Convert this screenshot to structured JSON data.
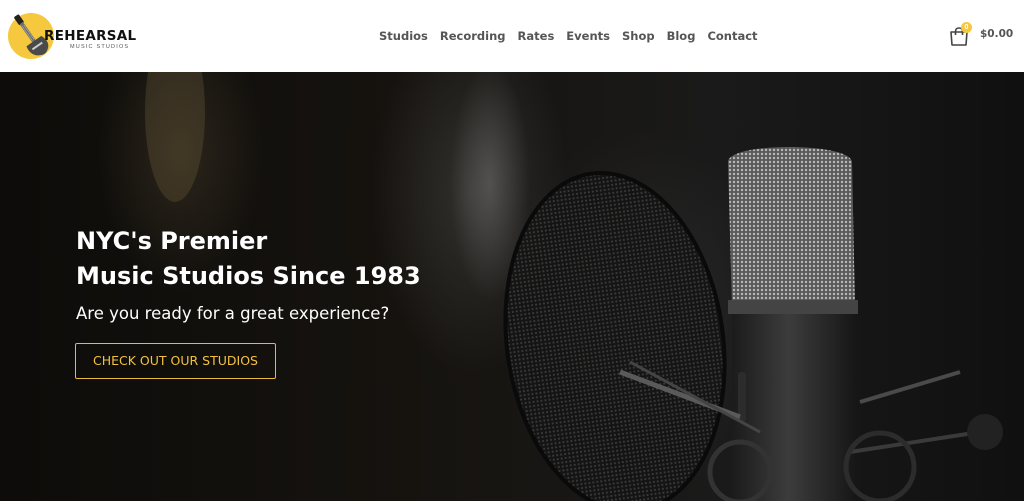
{
  "brand": {
    "name": "REHEARSAL",
    "tagline": "MUSIC STUDIOS",
    "accent_color": "#f5c83d"
  },
  "nav": {
    "items": [
      {
        "label": "Studios"
      },
      {
        "label": "Recording"
      },
      {
        "label": "Rates"
      },
      {
        "label": "Events"
      },
      {
        "label": "Shop"
      },
      {
        "label": "Blog"
      },
      {
        "label": "Contact"
      }
    ]
  },
  "cart": {
    "icon": "shopping-bag-icon",
    "count": "0",
    "total": "$0.00"
  },
  "hero": {
    "title_line1": "NYC's Premier",
    "title_line2": "Music Studios Since 1983",
    "subtitle": "Are you ready for a great experience?",
    "cta_label": "CHECK OUT OUR STUDIOS",
    "cta_color": "#e7ba3a"
  }
}
